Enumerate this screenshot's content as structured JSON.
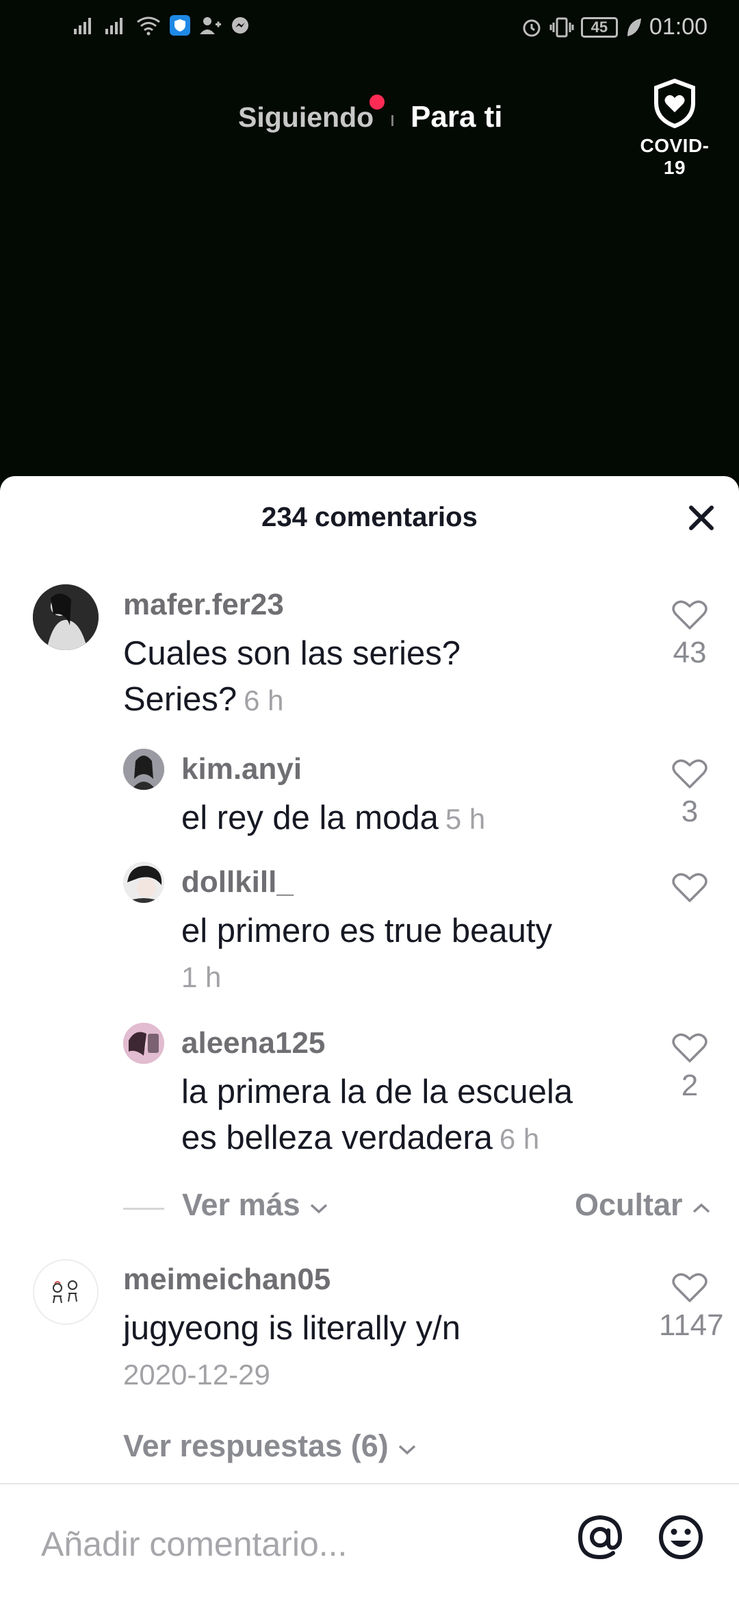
{
  "status_bar": {
    "battery": "45",
    "time": "01:00"
  },
  "top_nav": {
    "following": "Siguiendo",
    "for_you": "Para ti",
    "covid_label": "COVID-19"
  },
  "comments_sheet": {
    "title": "234 comentarios",
    "comments": [
      {
        "username": "mafer.fer23",
        "text_line1": "Cuales son las series?",
        "text_line2": "Series?",
        "time": "6 h",
        "likes": "43"
      },
      {
        "username": "kim.anyi",
        "text": "el rey de la moda",
        "time": "5 h",
        "likes": "3"
      },
      {
        "username": "dollkill_",
        "text": "el primero es true beauty",
        "time": "1 h",
        "likes": ""
      },
      {
        "username": "aleena125",
        "text_line1": "la primera la de la escuela",
        "text_line2": "es belleza verdadera",
        "time": "6 h",
        "likes": "2"
      },
      {
        "username": "meimeichan05",
        "text": "jugyeong is literally y/n",
        "time": "2020-12-29",
        "likes": "1147"
      }
    ],
    "view_more": "Ver más",
    "hide": "Ocultar",
    "view_replies": "Ver respuestas (6)"
  },
  "input": {
    "placeholder": "Añadir comentario..."
  }
}
